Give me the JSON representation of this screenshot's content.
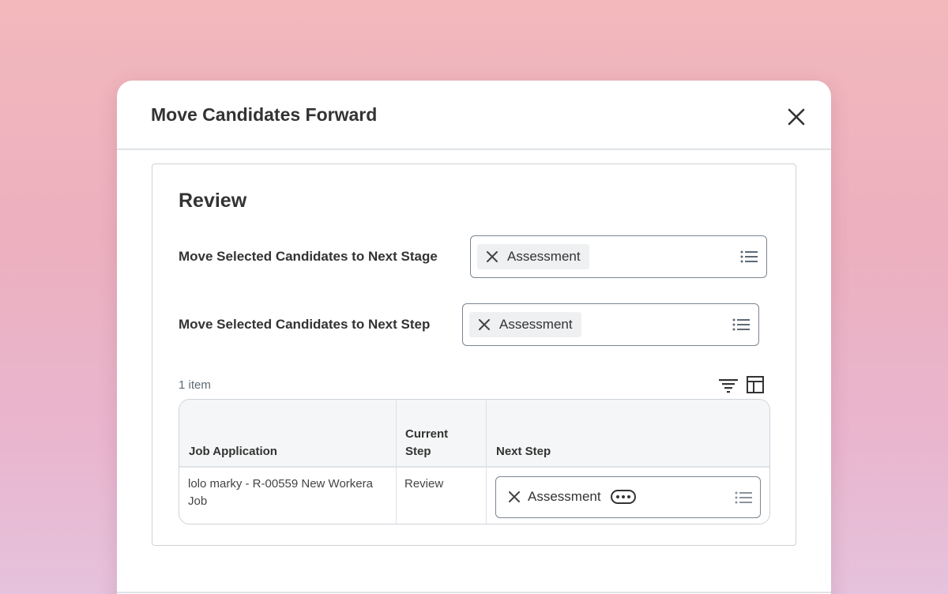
{
  "modal": {
    "title": "Move Candidates Forward",
    "close_icon": "close-icon"
  },
  "review": {
    "title": "Review",
    "stage_field": {
      "label": "Move Selected Candidates to Next Stage",
      "selected": "Assessment"
    },
    "step_field": {
      "label": "Move Selected Candidates to Next Step",
      "selected": "Assessment"
    }
  },
  "table": {
    "item_count": "1 item",
    "toolbar_icons": [
      "filter-icon",
      "column-layout-icon"
    ],
    "columns": [
      "Job Application",
      "Current Step",
      "Next Step"
    ],
    "rows": [
      {
        "job_application": "lolo marky - R-00559 New Workera Job",
        "current_step": "Review",
        "next_step": "Assessment"
      }
    ]
  },
  "colors": {
    "accent_text": "#333333",
    "border": "#7b858f",
    "pill_bg": "#eef0f2"
  }
}
